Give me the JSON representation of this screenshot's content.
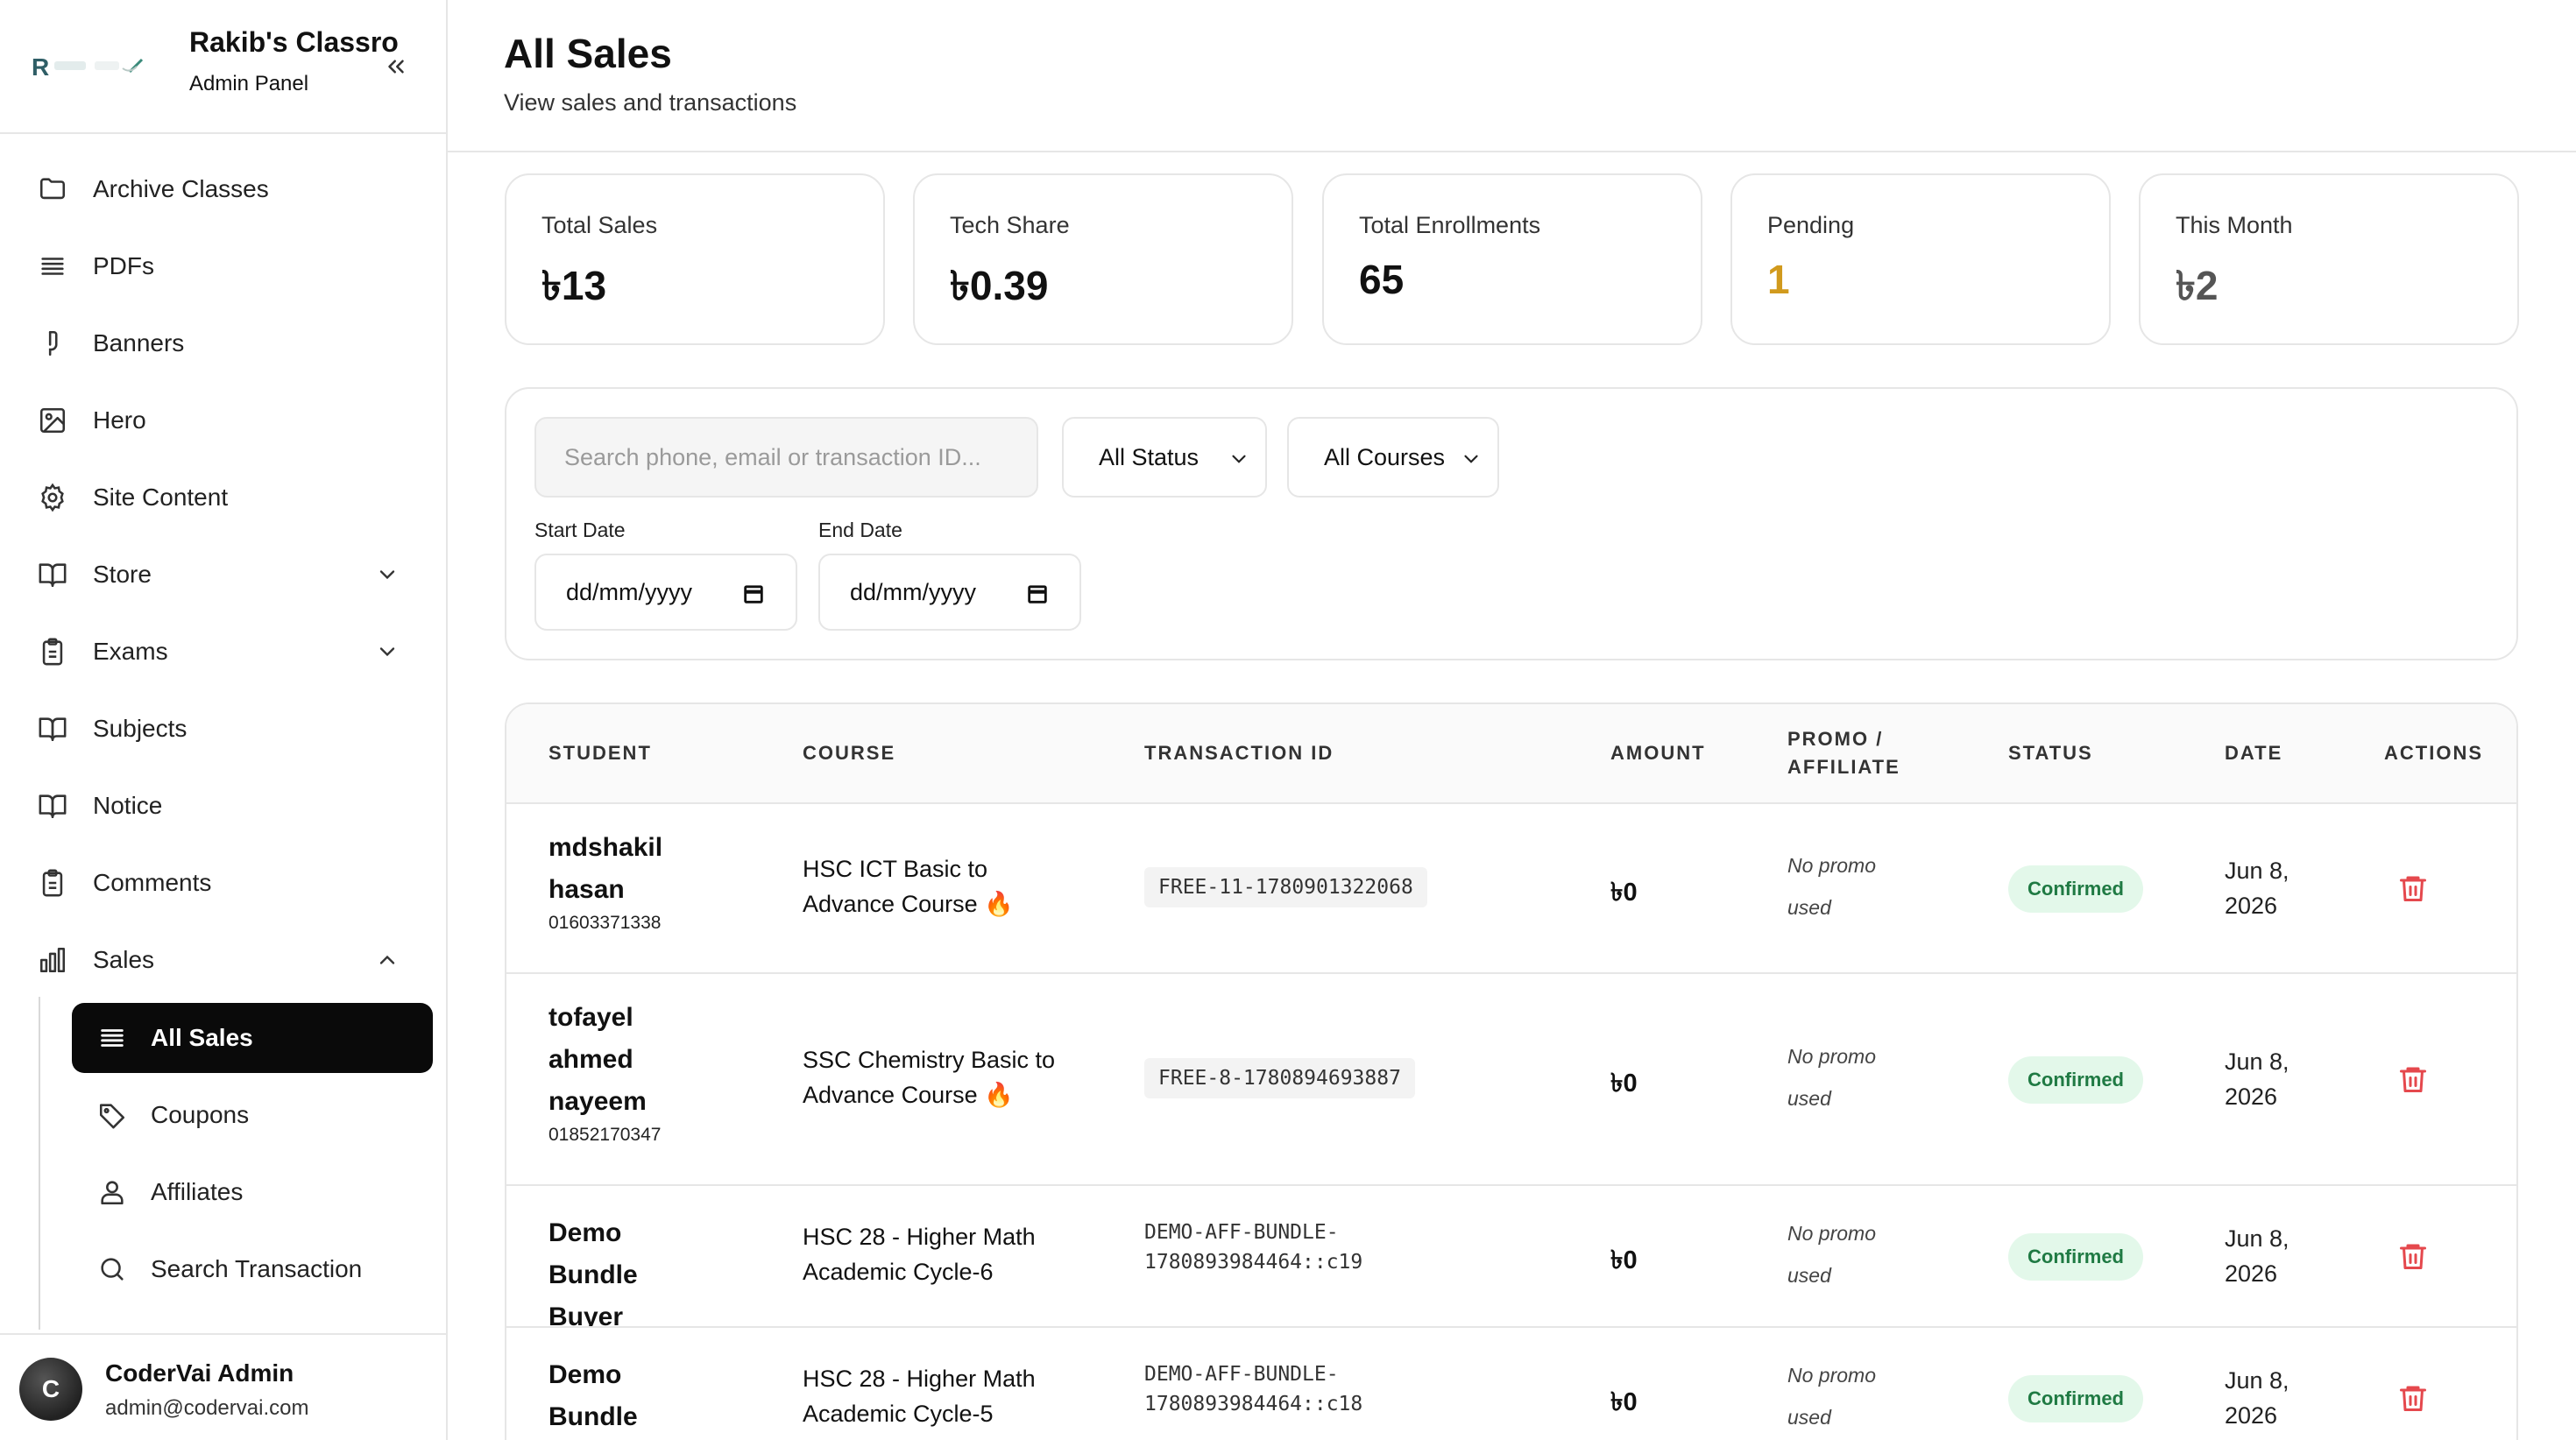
{
  "sidebar": {
    "brand_title": "Rakib's Classro",
    "brand_subtitle": "Admin Panel",
    "items": [
      {
        "label": "Archive Classes",
        "icon": "folder-icon"
      },
      {
        "label": "PDFs",
        "icon": "list-icon"
      },
      {
        "label": "Banners",
        "icon": "banner-icon"
      },
      {
        "label": "Hero",
        "icon": "image-icon"
      },
      {
        "label": "Site Content",
        "icon": "gear-icon"
      },
      {
        "label": "Store",
        "icon": "book-icon"
      },
      {
        "label": "Exams",
        "icon": "clipboard-icon"
      },
      {
        "label": "Subjects",
        "icon": "book-icon"
      },
      {
        "label": "Notice",
        "icon": "book-icon"
      },
      {
        "label": "Comments",
        "icon": "clipboard-icon"
      },
      {
        "label": "Sales",
        "icon": "bar-chart-icon"
      }
    ],
    "sales_sub": [
      {
        "label": "All Sales",
        "icon": "list-icon",
        "active": true
      },
      {
        "label": "Coupons",
        "icon": "tag-icon"
      },
      {
        "label": "Affiliates",
        "icon": "users-icon"
      },
      {
        "label": "Search Transaction",
        "icon": "search-icon"
      }
    ],
    "user": {
      "initial": "C",
      "name": "CoderVai Admin",
      "email": "admin@codervai.com"
    }
  },
  "header": {
    "title": "All Sales",
    "subtitle": "View sales and transactions"
  },
  "stats": [
    {
      "label": "Total Sales",
      "value": "৳13",
      "color": "#111111"
    },
    {
      "label": "Tech Share",
      "value": "৳0.39",
      "color": "#111111"
    },
    {
      "label": "Total Enrollments",
      "value": "65",
      "color": "#111111"
    },
    {
      "label": "Pending",
      "value": "1",
      "color": "#d19a1d"
    },
    {
      "label": "This Month",
      "value": "৳2",
      "color": "#555555"
    }
  ],
  "filters": {
    "search_placeholder": "Search phone, email or transaction ID...",
    "status_value": "All Status",
    "course_value": "All Courses",
    "start_label": "Start Date",
    "end_label": "End Date",
    "date_placeholder": "dd/mm/yyyy"
  },
  "table": {
    "headers": {
      "student": "STUDENT",
      "course": "COURSE",
      "transaction": "TRANSACTION ID",
      "amount": "AMOUNT",
      "promo": "PROMO / AFFILIATE",
      "status": "STATUS",
      "date": "DATE",
      "actions": "ACTIONS"
    },
    "rows": [
      {
        "name": "mdshakil hasan",
        "phone": "01603371338",
        "course": "HSC ICT Basic to Advance Course 🔥",
        "txid": "FREE-11-1780901322068",
        "amount": "৳0",
        "promo": "No promo used",
        "status": "Confirmed",
        "date": "Jun 8, 2026"
      },
      {
        "name": "tofayel ahmed nayeem",
        "phone": "01852170347",
        "course": "SSC Chemistry Basic to Advance Course 🔥",
        "txid": "FREE-8-1780894693887",
        "amount": "৳0",
        "promo": "No promo used",
        "status": "Confirmed",
        "date": "Jun 8, 2026"
      },
      {
        "name": "Demo Bundle Buyer",
        "phone": "",
        "course": "HSC 28 - Higher Math Academic Cycle-6",
        "txid": "DEMO-AFF-BUNDLE-1780893984464::c19",
        "amount": "৳0",
        "promo": "No promo used",
        "status": "Confirmed",
        "date": "Jun 8, 2026"
      },
      {
        "name": "Demo Bundle Buyer",
        "phone": "",
        "course": "HSC 28 - Higher Math Academic Cycle-5",
        "txid": "DEMO-AFF-BUNDLE-1780893984464::c18",
        "amount": "৳0",
        "promo": "No promo used",
        "status": "Confirmed",
        "date": "Jun 8, 2026"
      }
    ]
  }
}
